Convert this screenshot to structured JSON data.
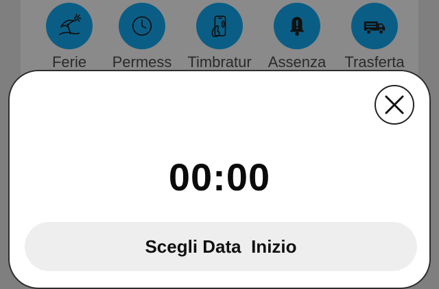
{
  "quick_actions": [
    {
      "label": "Ferie",
      "icon": "beach-umbrella-icon"
    },
    {
      "label": "Permess",
      "icon": "clock-icon"
    },
    {
      "label": "Timbratur",
      "icon": "phone-tap-icon"
    },
    {
      "label": "Assenza",
      "icon": "bell-alert-icon"
    },
    {
      "label": "Trasferta",
      "icon": "truck-icon"
    }
  ],
  "sheet": {
    "time": "00:00",
    "choose_start_date": "Scegli Data  Inizio",
    "close_icon": "close-icon"
  },
  "colors": {
    "accent": "#0a5e86",
    "overlay": "#7f7f7f",
    "button_bg": "#eeeeee"
  }
}
